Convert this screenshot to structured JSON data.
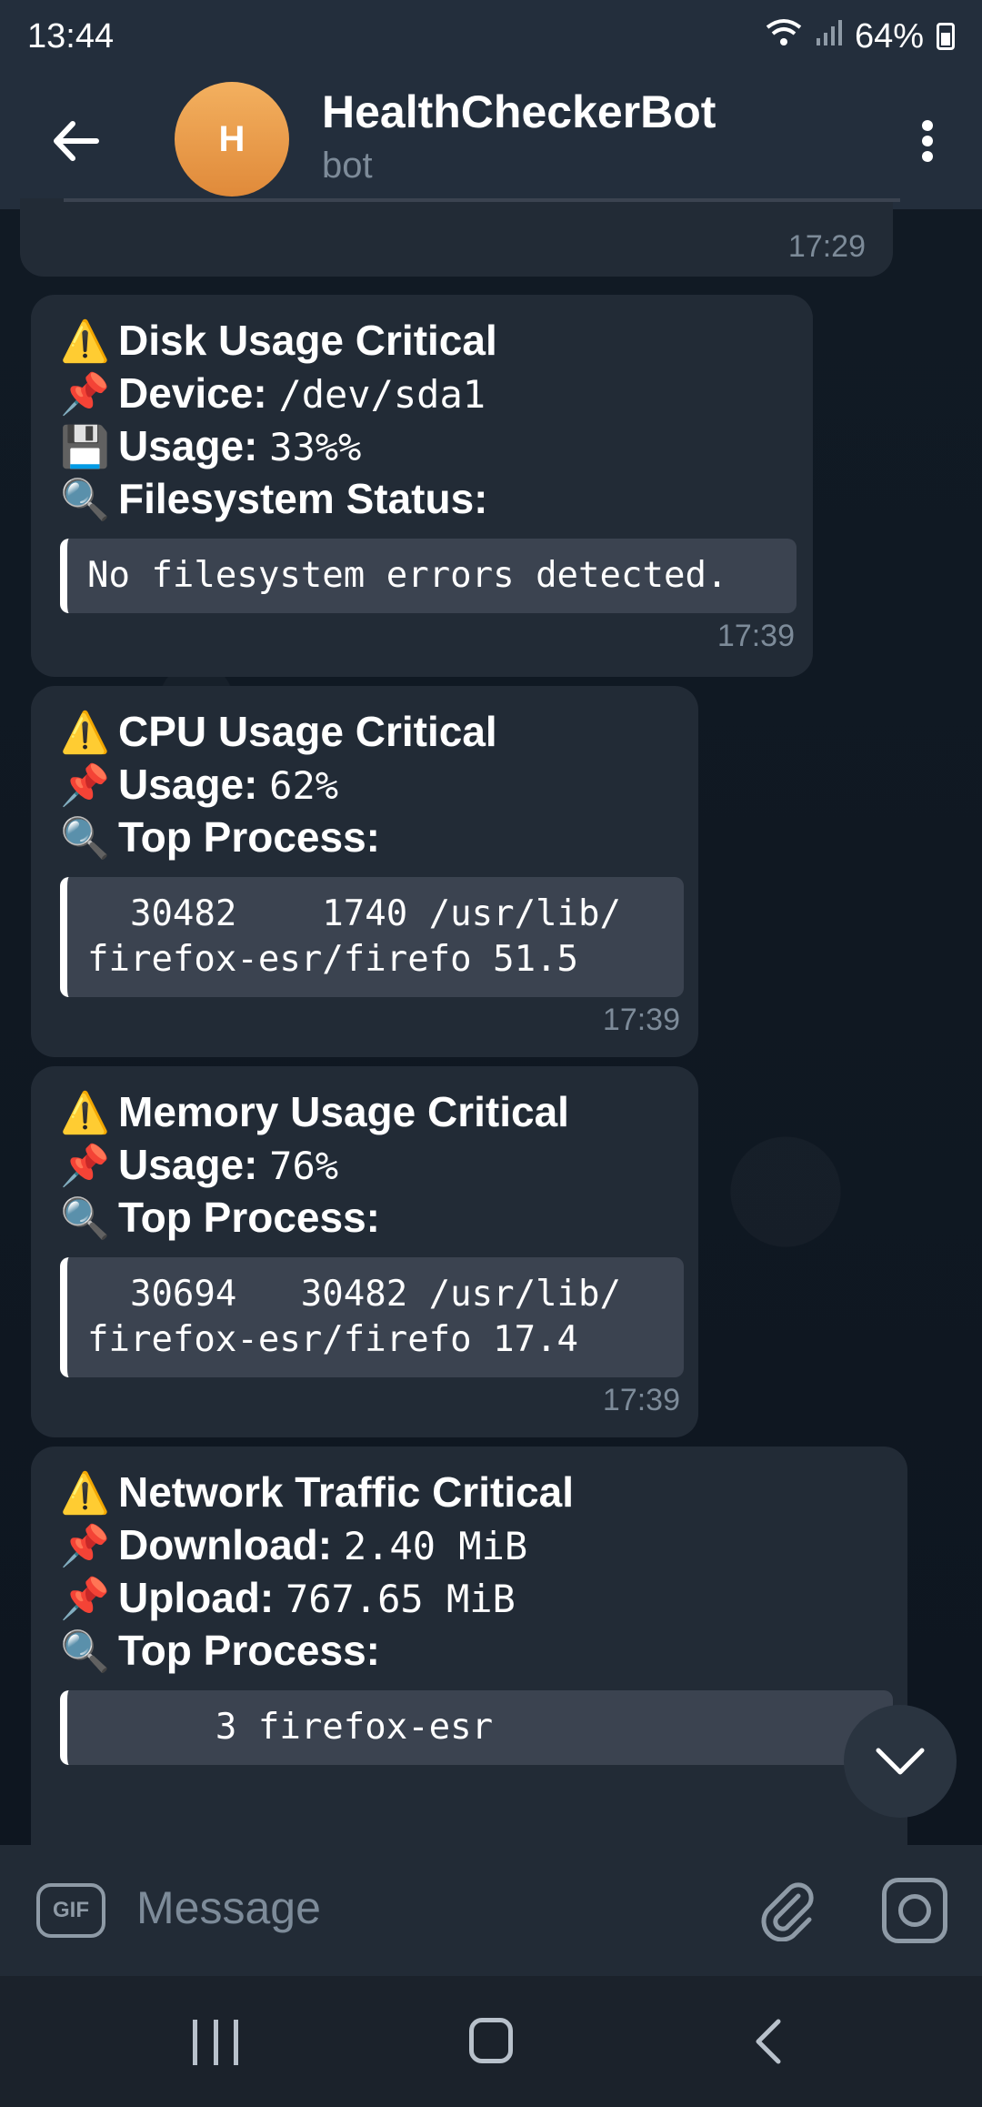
{
  "status_bar": {
    "time": "13:44",
    "battery": "64%"
  },
  "header": {
    "avatar_letter": "H",
    "title": "HealthCheckerBot",
    "subtitle": "bot"
  },
  "messages": [
    {
      "time": "17:29"
    },
    {
      "title": "Disk Usage Critical",
      "device_label": "Device:",
      "device_value": "/dev/sda1",
      "usage_label": "Usage:",
      "usage_value": "33%%",
      "status_label": "Filesystem Status:",
      "code": "No filesystem errors detected.",
      "time": "17:39"
    },
    {
      "title": "CPU Usage Critical",
      "usage_label": "Usage:",
      "usage_value": "62%",
      "top_label": "Top Process:",
      "code": "  30482    1740 /usr/lib/\nfirefox-esr/firefo 51.5",
      "time": "17:39"
    },
    {
      "title": "Memory Usage Critical",
      "usage_label": "Usage:",
      "usage_value": "76%",
      "top_label": "Top Process:",
      "code": "  30694   30482 /usr/lib/\nfirefox-esr/firefo 17.4",
      "time": "17:39"
    },
    {
      "title": "Network Traffic Critical",
      "download_label": "Download:",
      "download_value": "2.40 MiB",
      "upload_label": "Upload:",
      "upload_value": "767.65 MiB",
      "top_label": "Top Process:",
      "code": "      3 firefox-esr"
    }
  ],
  "composer": {
    "gif_label": "GIF",
    "placeholder": "Message"
  },
  "icons": {
    "warning": "⚠️",
    "pin": "📌",
    "disk": "💾",
    "magnifier": "🔍"
  }
}
